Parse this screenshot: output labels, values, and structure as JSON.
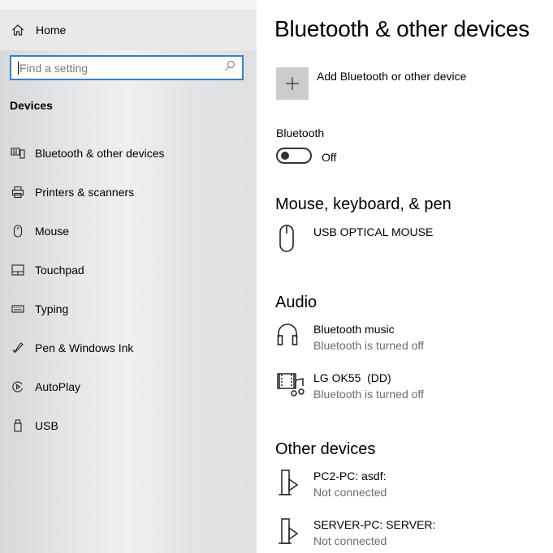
{
  "sidebar": {
    "home_label": "Home",
    "search_placeholder": "Find a setting",
    "section_title": "Devices",
    "items": [
      {
        "label": "Bluetooth & other devices",
        "icon": "bluetooth-devices-icon"
      },
      {
        "label": "Printers & scanners",
        "icon": "printer-icon"
      },
      {
        "label": "Mouse",
        "icon": "mouse-icon"
      },
      {
        "label": "Touchpad",
        "icon": "touchpad-icon"
      },
      {
        "label": "Typing",
        "icon": "keyboard-icon"
      },
      {
        "label": "Pen & Windows Ink",
        "icon": "pen-icon"
      },
      {
        "label": "AutoPlay",
        "icon": "autoplay-icon"
      },
      {
        "label": "USB",
        "icon": "usb-icon"
      }
    ]
  },
  "main": {
    "title": "Bluetooth & other devices",
    "add_label": "Add Bluetooth or other device",
    "bluetooth_label": "Bluetooth",
    "bluetooth_state": "Off",
    "sections": {
      "mouse_keyboard": {
        "heading": "Mouse, keyboard, & pen",
        "devices": [
          {
            "name": "USB OPTICAL MOUSE",
            "status": ""
          }
        ]
      },
      "audio": {
        "heading": "Audio",
        "devices": [
          {
            "name": "Bluetooth music",
            "status": "Bluetooth is turned off"
          },
          {
            "name": "LG OK55  (DD)",
            "status": "Bluetooth is turned off"
          }
        ]
      },
      "other": {
        "heading": "Other devices",
        "devices": [
          {
            "name": "PC2-PC: asdf:",
            "status": "Not connected"
          },
          {
            "name": "SERVER-PC: SERVER:",
            "status": "Not connected"
          }
        ]
      }
    }
  },
  "colors": {
    "search_border": "#3a7fc2",
    "add_button_bg": "#cccccc",
    "status_text": "#6b6b6b"
  }
}
